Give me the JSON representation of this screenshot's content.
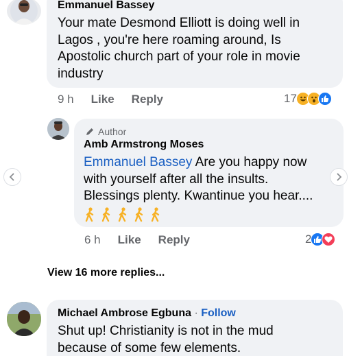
{
  "comment1": {
    "author": "Emmanuel Bassey",
    "lines": [
      "Your mate Desmond Elliott is doing well in",
      "Lagos , you're here roaming around, Is",
      "Apostolic church part of your role in movie",
      "industry"
    ],
    "time": "9 h",
    "like_label": "Like",
    "reply_label": "Reply",
    "reaction_count": "17",
    "reactions": [
      "haha",
      "wow",
      "like"
    ]
  },
  "reply1": {
    "author_tag": "Author",
    "author": "Amb Armstrong Moses",
    "mention": "Emmanuel Bassey",
    "lines": [
      " Are you happy now",
      "with yourself after all the insults.",
      "Blessings plenty. Kwantinue you hear...."
    ],
    "emoji_count": 5,
    "time": "6 h",
    "like_label": "Like",
    "reply_label": "Reply",
    "reaction_count": "2",
    "reactions": [
      "like",
      "love"
    ]
  },
  "view_more": "View 16 more replies...",
  "comment2": {
    "author": "Michael Ambrose Egbuna",
    "separator": " · ",
    "follow_label": "Follow",
    "lines": [
      "Shut up! Christianity is not in the mud",
      "because of some few elements."
    ]
  },
  "colors": {
    "bubble": "#f0f2f5",
    "link": "#1a5fc2",
    "meta": "#65676b",
    "like_blue": "#1877f2",
    "love_red": "#f33e58",
    "haha_yellow": "#f7b125"
  }
}
